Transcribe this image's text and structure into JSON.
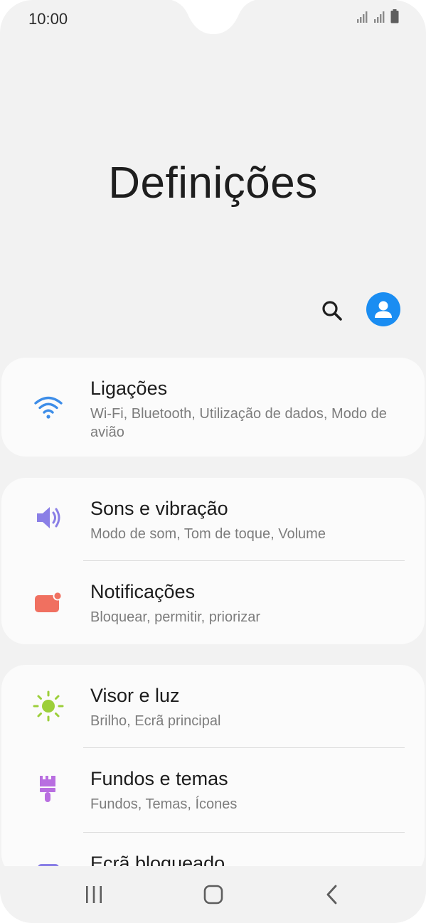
{
  "status_bar": {
    "time": "10:00",
    "icons": [
      "signal-icon",
      "signal-icon",
      "battery-icon"
    ]
  },
  "header": {
    "title": "Definições",
    "search_icon": "search-icon",
    "profile_icon": "account-icon"
  },
  "settings": [
    {
      "title": "Ligações",
      "subtitle": "Wi-Fi, Bluetooth, Utilização de dados, Modo de avião",
      "icon": "wifi-icon",
      "color": "#3d8de8"
    },
    {
      "title": "Sons e vibração",
      "subtitle": "Modo de som, Tom de toque, Volume",
      "icon": "speaker-icon",
      "color": "#8a7fe6"
    },
    {
      "title": "Notificações",
      "subtitle": "Bloquear, permitir, priorizar",
      "icon": "notification-icon",
      "color": "#f07060"
    },
    {
      "title": "Visor e luz",
      "subtitle": "Brilho, Ecrã principal",
      "icon": "brightness-icon",
      "color": "#9ccf3a"
    },
    {
      "title": "Fundos e temas",
      "subtitle": "Fundos, Temas, Ícones",
      "icon": "paintbrush-icon",
      "color": "#b86ee0"
    },
    {
      "title": "Ecrã bloqueado",
      "subtitle": "",
      "icon": "lock-screen-icon",
      "color": "#8a7fe6"
    }
  ],
  "nav_bar": {
    "recents": "recents-icon",
    "home": "home-icon",
    "back": "back-icon"
  },
  "colors": {
    "background": "#f2f2f2",
    "card": "#fbfbfb",
    "accent": "#1a8df2"
  }
}
